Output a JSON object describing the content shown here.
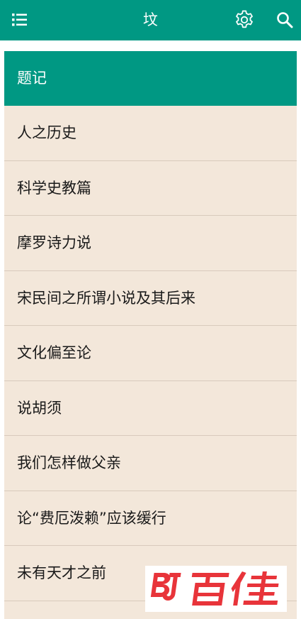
{
  "appbar": {
    "title": "坟",
    "menu_icon": "list-menu-icon",
    "settings_icon": "gear-icon",
    "search_icon": "search-icon"
  },
  "list": {
    "header": "题记",
    "items": [
      "人之历史",
      "科学史教篇",
      "摩罗诗力说",
      "宋民间之所谓小说及其后来",
      "文化偏至论",
      "说胡须",
      "我们怎样做父亲",
      "论“费厄泼赖”应该缓行",
      "未有天才之前"
    ]
  },
  "watermark": {
    "text": "BJ百佳"
  },
  "colors": {
    "primary": "#009883",
    "list_background": "#f3e7da",
    "divider": "#d8cabc",
    "watermark_red": "#e8343a"
  }
}
